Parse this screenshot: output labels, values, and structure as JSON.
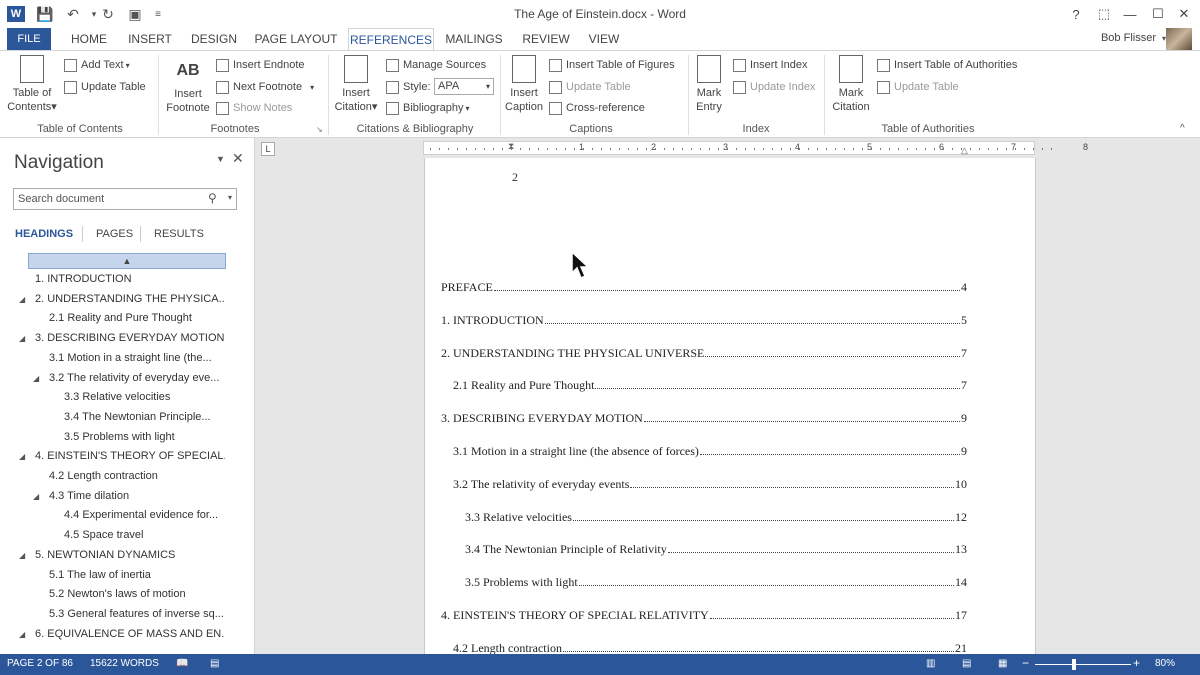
{
  "window": {
    "title": "The Age of Einstein.docx - Word",
    "user": "Bob Flisser",
    "word_icon": "W",
    "help_glyph": "?",
    "ribbon_display_glyph": "⬚",
    "minimize_glyph": "—",
    "maximize_glyph": "☐",
    "close_glyph": "✕"
  },
  "tabs": {
    "file": "FILE",
    "items": [
      "HOME",
      "INSERT",
      "DESIGN",
      "PAGE LAYOUT",
      "REFERENCES",
      "MAILINGS",
      "REVIEW",
      "VIEW"
    ],
    "active": "REFERENCES"
  },
  "ribbon": {
    "toc": {
      "btn1": "Table of",
      "btn2": "Contents",
      "add_text": "Add Text",
      "update_table": "Update Table",
      "label": "Table of Contents"
    },
    "footnotes": {
      "insert1": "Insert",
      "insert2": "Footnote",
      "insert_endnote": "Insert Endnote",
      "next_footnote": "Next Footnote",
      "show_notes": "Show Notes",
      "label": "Footnotes",
      "ab_glyph": "AB"
    },
    "citations": {
      "insert1": "Insert",
      "insert2": "Citation",
      "manage_sources": "Manage Sources",
      "style_label": "Style:",
      "style_value": "APA",
      "bibliography": "Bibliography",
      "label": "Citations & Bibliography"
    },
    "captions": {
      "insert1": "Insert",
      "insert2": "Caption",
      "insert_tof": "Insert Table of Figures",
      "update_table": "Update Table",
      "cross_ref": "Cross-reference",
      "label": "Captions"
    },
    "index": {
      "mark1": "Mark",
      "mark2": "Entry",
      "insert_index": "Insert Index",
      "update_index": "Update Index",
      "label": "Index"
    },
    "authorities": {
      "mark1": "Mark",
      "mark2": "Citation",
      "insert_toa": "Insert Table of Authorities",
      "update_table": "Update Table",
      "label": "Table of Authorities"
    }
  },
  "nav": {
    "title": "Navigation",
    "search_placeholder": "Search document",
    "tabs": [
      "HEADINGS",
      "PAGES",
      "RESULTS"
    ],
    "items": [
      {
        "text": "1.  INTRODUCTION",
        "level": 1,
        "expander": false
      },
      {
        "text": "2.  UNDERSTANDING THE PHYSICA...",
        "level": 1,
        "expander": true
      },
      {
        "text": "2.1  Reality and Pure Thought",
        "level": 2,
        "expander": false
      },
      {
        "text": "3.  DESCRIBING EVERYDAY MOTION",
        "level": 1,
        "expander": true
      },
      {
        "text": "3.1  Motion in a straight line (the...",
        "level": 2,
        "expander": false
      },
      {
        "text": "3.2  The relativity of everyday eve...",
        "level": 2,
        "expander": true
      },
      {
        "text": "3.3  Relative velocities",
        "level": 3,
        "expander": false
      },
      {
        "text": "3.4  The Newtonian Principle...",
        "level": 3,
        "expander": false
      },
      {
        "text": "3.5  Problems with light",
        "level": 3,
        "expander": false
      },
      {
        "text": "4.  EINSTEIN'S THEORY OF SPECIAL...",
        "level": 1,
        "expander": true
      },
      {
        "text": "4.2  Length contraction",
        "level": 2,
        "expander": false
      },
      {
        "text": "4.3  Time dilation",
        "level": 2,
        "expander": true
      },
      {
        "text": "4.4  Experimental evidence for...",
        "level": 3,
        "expander": false
      },
      {
        "text": "4.5  Space travel",
        "level": 3,
        "expander": false
      },
      {
        "text": "5.  NEWTONIAN DYNAMICS",
        "level": 1,
        "expander": true
      },
      {
        "text": "5.1  The law of inertia",
        "level": 2,
        "expander": false
      },
      {
        "text": "5.2  Newton's laws of motion",
        "level": 2,
        "expander": false
      },
      {
        "text": "5.3  General features of inverse sq...",
        "level": 2,
        "expander": false
      },
      {
        "text": "6.  EQUIVALENCE OF MASS AND EN...",
        "level": 1,
        "expander": true
      }
    ]
  },
  "document": {
    "ruler_numbers": [
      "1",
      "2",
      "3",
      "4",
      "5",
      "6",
      "7",
      "8"
    ],
    "ruler_corner": "L",
    "page_number": "2",
    "toc": [
      {
        "text": "PREFACE",
        "page": "4",
        "level": 0
      },
      {
        "text": "1.  INTRODUCTION",
        "page": "5",
        "level": 0
      },
      {
        "text": "2.  UNDERSTANDING THE PHYSICAL UNIVERSE",
        "page": "7",
        "level": 0
      },
      {
        "text": "2.1  Reality and Pure Thought",
        "page": "7",
        "level": 1
      },
      {
        "text": "3.  DESCRIBING EVERYDAY MOTION",
        "page": "9",
        "level": 0
      },
      {
        "text": "3.1  Motion in a straight line (the absence of forces)",
        "page": "9",
        "level": 1
      },
      {
        "text": "3.2  The relativity of everyday events",
        "page": "10",
        "level": 1
      },
      {
        "text": "3.3  Relative velocities",
        "page": "12",
        "level": 2
      },
      {
        "text": "3.4  The Newtonian Principle of Relativity",
        "page": "13",
        "level": 2
      },
      {
        "text": "3.5  Problems with light",
        "page": "14",
        "level": 2
      },
      {
        "text": "4.  EINSTEIN'S THEORY OF SPECIAL RELATIVITY",
        "page": "17",
        "level": 0
      },
      {
        "text": "4.2  Length contraction",
        "page": "21",
        "level": 1
      }
    ]
  },
  "status": {
    "page": "PAGE 2 OF 86",
    "words": "15622 WORDS",
    "zoom": "80%",
    "zoom_minus": "−",
    "zoom_plus": "+"
  },
  "colors": {
    "accent": "#2b579a",
    "nav_highlight": "#c5d5ec"
  }
}
